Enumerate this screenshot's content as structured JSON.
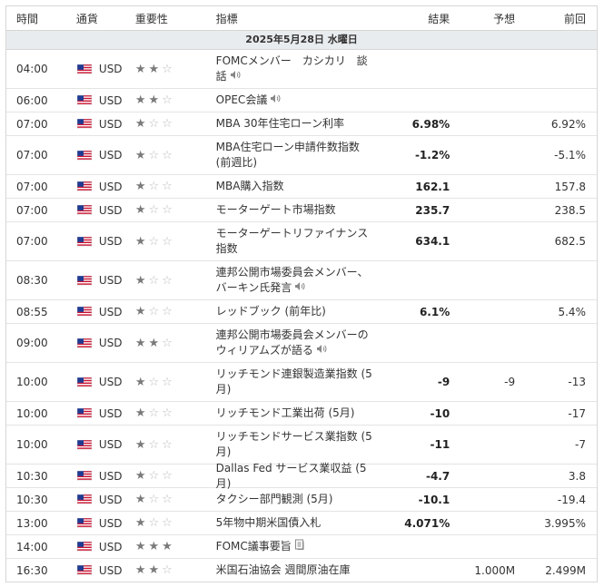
{
  "header": {
    "time": "時間",
    "currency": "通貨",
    "importance": "重要性",
    "event": "指標",
    "actual": "結果",
    "forecast": "予想",
    "previous": "前回"
  },
  "date_label": "2025年5月28日 水曜日",
  "colors": {
    "border": "#d6d6d6",
    "date_bg": "#e9ecef",
    "star_on": "#7a7a7a",
    "star_off": "#bdbdbd"
  },
  "rows": [
    {
      "time": "04:00",
      "currency": "USD",
      "stars": 2,
      "event_lines": [
        "FOMCメンバー　カシカリ　談",
        "話"
      ],
      "icon": "speaker-icon",
      "actual": "",
      "forecast": "",
      "previous": ""
    },
    {
      "time": "06:00",
      "currency": "USD",
      "stars": 2,
      "event_lines": [
        "OPEC会議"
      ],
      "icon": "speaker-icon",
      "actual": "",
      "forecast": "",
      "previous": ""
    },
    {
      "time": "07:00",
      "currency": "USD",
      "stars": 1,
      "event_lines": [
        "MBA 30年住宅ローン利率"
      ],
      "icon": "",
      "actual": "6.98%",
      "forecast": "",
      "previous": "6.92%"
    },
    {
      "time": "07:00",
      "currency": "USD",
      "stars": 1,
      "event_lines": [
        "MBA住宅ローン申請件数指数",
        "(前週比)"
      ],
      "icon": "",
      "actual": "-1.2%",
      "forecast": "",
      "previous": "-5.1%"
    },
    {
      "time": "07:00",
      "currency": "USD",
      "stars": 1,
      "event_lines": [
        "MBA購入指数"
      ],
      "icon": "",
      "actual": "162.1",
      "forecast": "",
      "previous": "157.8"
    },
    {
      "time": "07:00",
      "currency": "USD",
      "stars": 1,
      "event_lines": [
        "モーターゲート市場指数"
      ],
      "icon": "",
      "actual": "235.7",
      "forecast": "",
      "previous": "238.5"
    },
    {
      "time": "07:00",
      "currency": "USD",
      "stars": 1,
      "event_lines": [
        "モーターゲートリファイナンス",
        "指数"
      ],
      "icon": "",
      "actual": "634.1",
      "forecast": "",
      "previous": "682.5"
    },
    {
      "time": "08:30",
      "currency": "USD",
      "stars": 1,
      "event_lines": [
        "連邦公開市場委員会メンバー、",
        "バーキン氏発言"
      ],
      "icon": "speaker-icon",
      "actual": "",
      "forecast": "",
      "previous": ""
    },
    {
      "time": "08:55",
      "currency": "USD",
      "stars": 1,
      "event_lines": [
        "レッドブック (前年比)"
      ],
      "icon": "",
      "actual": "6.1%",
      "forecast": "",
      "previous": "5.4%"
    },
    {
      "time": "09:00",
      "currency": "USD",
      "stars": 2,
      "event_lines": [
        "連邦公開市場委員会メンバーの",
        "ウィリアムズが語る"
      ],
      "icon": "speaker-icon",
      "actual": "",
      "forecast": "",
      "previous": ""
    },
    {
      "time": "10:00",
      "currency": "USD",
      "stars": 1,
      "event_lines": [
        "リッチモンド連銀製造業指数 (5",
        "月)"
      ],
      "icon": "",
      "actual": "-9",
      "forecast": "-9",
      "previous": "-13"
    },
    {
      "time": "10:00",
      "currency": "USD",
      "stars": 1,
      "event_lines": [
        "リッチモンド工業出荷 (5月)"
      ],
      "icon": "",
      "actual": "-10",
      "forecast": "",
      "previous": "-17"
    },
    {
      "time": "10:00",
      "currency": "USD",
      "stars": 1,
      "event_lines": [
        "リッチモンドサービス業指数 (5",
        "月)"
      ],
      "icon": "",
      "actual": "-11",
      "forecast": "",
      "previous": "-7"
    },
    {
      "time": "10:30",
      "currency": "USD",
      "stars": 1,
      "event_lines": [
        "Dallas Fed サービス業収益 (5月)"
      ],
      "icon": "",
      "actual": "-4.7",
      "forecast": "",
      "previous": "3.8"
    },
    {
      "time": "10:30",
      "currency": "USD",
      "stars": 1,
      "event_lines": [
        "タクシー部門観測 (5月)"
      ],
      "icon": "",
      "actual": "-10.1",
      "forecast": "",
      "previous": "-19.4"
    },
    {
      "time": "13:00",
      "currency": "USD",
      "stars": 1,
      "event_lines": [
        "5年物中期米国債入札"
      ],
      "icon": "",
      "actual": "4.071%",
      "forecast": "",
      "previous": "3.995%"
    },
    {
      "time": "14:00",
      "currency": "USD",
      "stars": 3,
      "event_lines": [
        "FOMC議事要旨"
      ],
      "icon": "document-icon",
      "actual": "",
      "forecast": "",
      "previous": ""
    },
    {
      "time": "16:30",
      "currency": "USD",
      "stars": 2,
      "event_lines": [
        "米国石油協会 週間原油在庫"
      ],
      "icon": "",
      "actual": "",
      "forecast": "1.000M",
      "previous": "2.499M"
    }
  ]
}
